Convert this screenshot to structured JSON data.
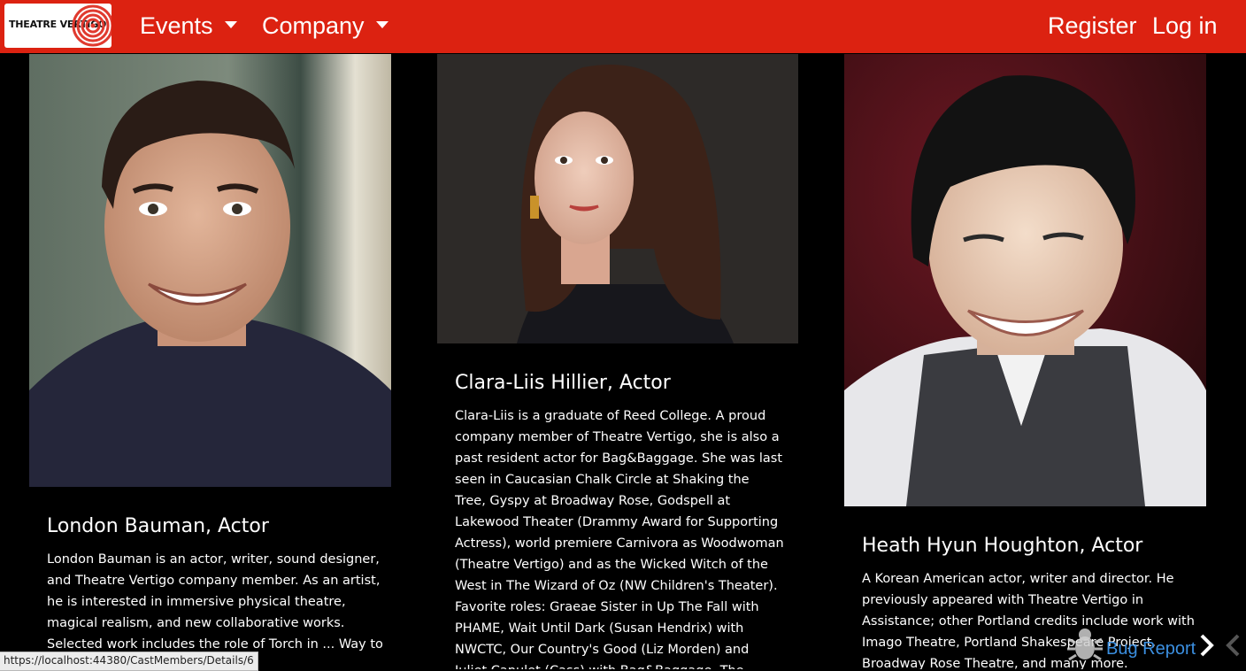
{
  "nav": {
    "logo_text": "THEATRE VERTIGO",
    "items": [
      {
        "label": "Events"
      },
      {
        "label": "Company"
      }
    ],
    "register_label": "Register",
    "login_label": "Log in"
  },
  "cast": [
    {
      "name": "London Bauman, Actor",
      "bio": "London Bauman is an actor, writer, sound designer, and Theatre Vertigo company member. As an artist, he is interested in immersive physical theatre, magical realism, and new collaborative works. Selected work includes the role of Torch in ... Way to Heaven)..."
    },
    {
      "name": "Clara-Liis Hillier, Actor",
      "bio": "Clara-Liis is a graduate of Reed College. A proud company member of Theatre Vertigo, she is also a past resident actor for Bag&Baggage. She was last seen in Caucasian Chalk Circle at Shaking the Tree, Gyspy at Broadway Rose, Godspell at Lakewood Theater (Drammy Award for Supporting Actress), world premiere Carnivora as Woodwoman (Theatre Vertigo) and as the Wicked Witch of the West in The Wizard of Oz (NW Children's Theater). Favorite roles: Graeae Sister in Up The Fall with PHAME, Wait Until Dark (Susan Hendrix) with NWCTC, Our Country's Good (Liz Morden) and Juliet Capulet (Cass) with Bag&Baggage. The..."
    },
    {
      "name": "Heath Hyun Houghton, Actor",
      "bio": "A Korean American actor, writer and director. He previously appeared with Theatre Vertigo in Assistance; other Portland credits include work with Imago Theatre, Portland Shakespeare Project, Broadway Rose Theatre, and many more."
    }
  ],
  "status_url": "https://localhost:44380/CastMembers/Details/6",
  "bug_report_label": "Bug Report",
  "colors": {
    "navbar": "#dc2211",
    "background": "#000000",
    "link": "#3b8fe0"
  }
}
